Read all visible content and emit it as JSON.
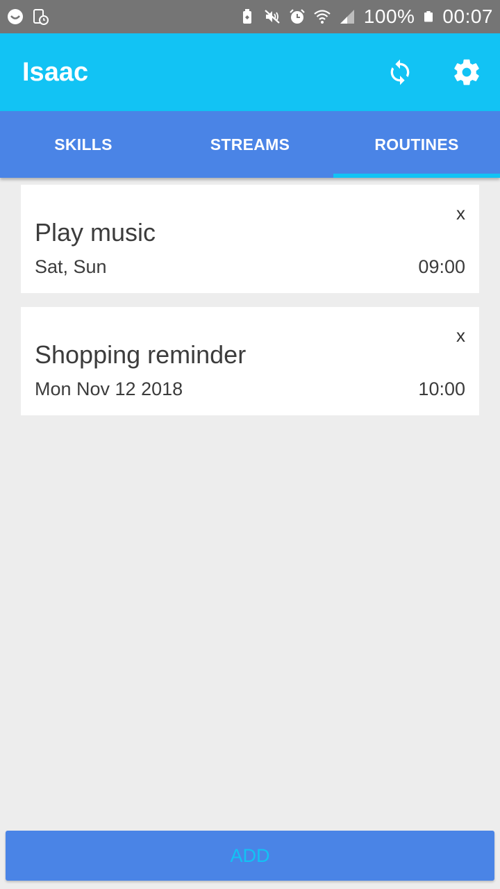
{
  "status_bar": {
    "battery": "100%",
    "time": "00:07",
    "icons": [
      "smiley-icon",
      "screen-timer-icon",
      "battery-saver-icon",
      "mute-icon",
      "alarm-icon",
      "wifi-icon",
      "signal-icon",
      "battery-icon"
    ]
  },
  "app_bar": {
    "title": "Isaac",
    "actions": [
      "sync-icon",
      "settings-gear-icon"
    ]
  },
  "tabs": [
    {
      "label": "SKILLS",
      "active": false
    },
    {
      "label": "STREAMS",
      "active": false
    },
    {
      "label": "ROUTINES",
      "active": true
    }
  ],
  "routines": [
    {
      "title": "Play music",
      "days": "Sat, Sun",
      "time": "09:00",
      "close": "x"
    },
    {
      "title": "Shopping reminder",
      "days": "Mon Nov 12 2018",
      "time": "10:00",
      "close": "x"
    }
  ],
  "add_button": {
    "label": "ADD"
  },
  "colors": {
    "status_bar": "#757575",
    "app_bar": "#12c3f4",
    "tab_bar": "#4a84e6",
    "tab_indicator": "#12c3f4",
    "background": "#ededed",
    "add_text": "#12c3f4"
  }
}
